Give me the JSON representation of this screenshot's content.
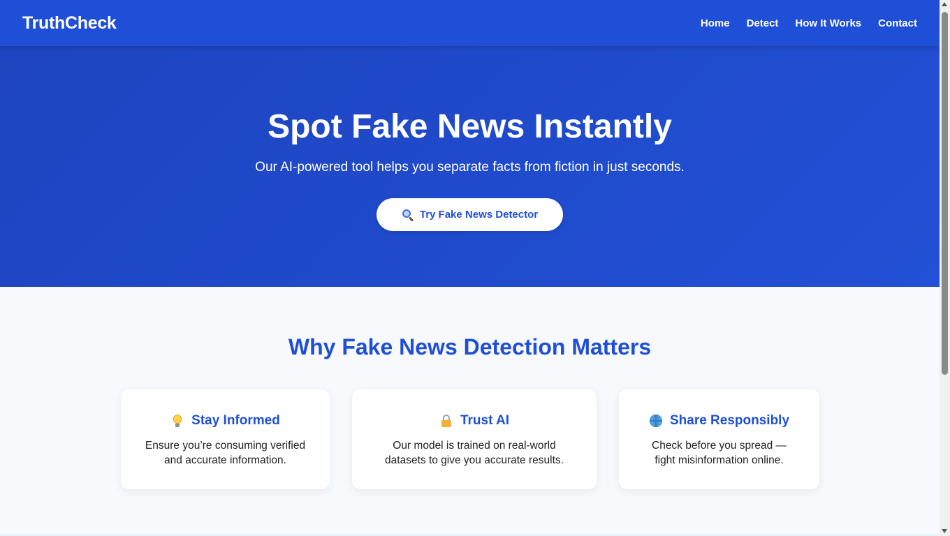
{
  "nav": {
    "brand": "TruthCheck",
    "links": [
      "Home",
      "Detect",
      "How It Works",
      "Contact"
    ]
  },
  "hero": {
    "title": "Spot Fake News Instantly",
    "subtitle": "Our AI-powered tool helps you separate facts from fiction in just seconds.",
    "cta_label": "Try Fake News Detector",
    "cta_icon": "magnifying-glass-icon"
  },
  "why": {
    "title": "Why Fake News Detection Matters",
    "cards": [
      {
        "icon": "lightbulb-icon",
        "title": "Stay Informed",
        "text_lines": [
          "Ensure you’re consuming verified",
          "and accurate information."
        ]
      },
      {
        "icon": "lock-icon",
        "title": "Trust AI",
        "text_lines": [
          "Our model is trained on real-world",
          "datasets to give you accurate results."
        ]
      },
      {
        "icon": "globe-icon",
        "title": "Share Responsibly",
        "text_lines": [
          "Check before you spread —",
          "fight misinformation online."
        ]
      }
    ]
  },
  "colors": {
    "primary": "#1f4fd6",
    "hero_gradient_start": "#1e44c0",
    "hero_gradient_end": "#2250d6",
    "background": "#f7f9fc",
    "card_bg": "#ffffff"
  }
}
